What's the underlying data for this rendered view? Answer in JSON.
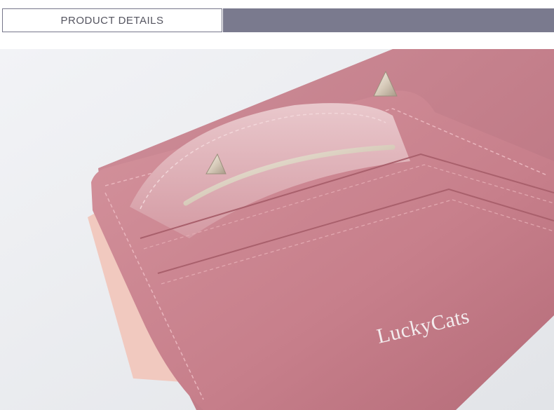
{
  "header": {
    "title": "PRODUCT DETAILS"
  },
  "product": {
    "brand_text": "LuckyCats"
  },
  "colors": {
    "header_bar": "#7a7a8e",
    "wallet_pink": "#c9838f",
    "background": "#eceef1"
  }
}
